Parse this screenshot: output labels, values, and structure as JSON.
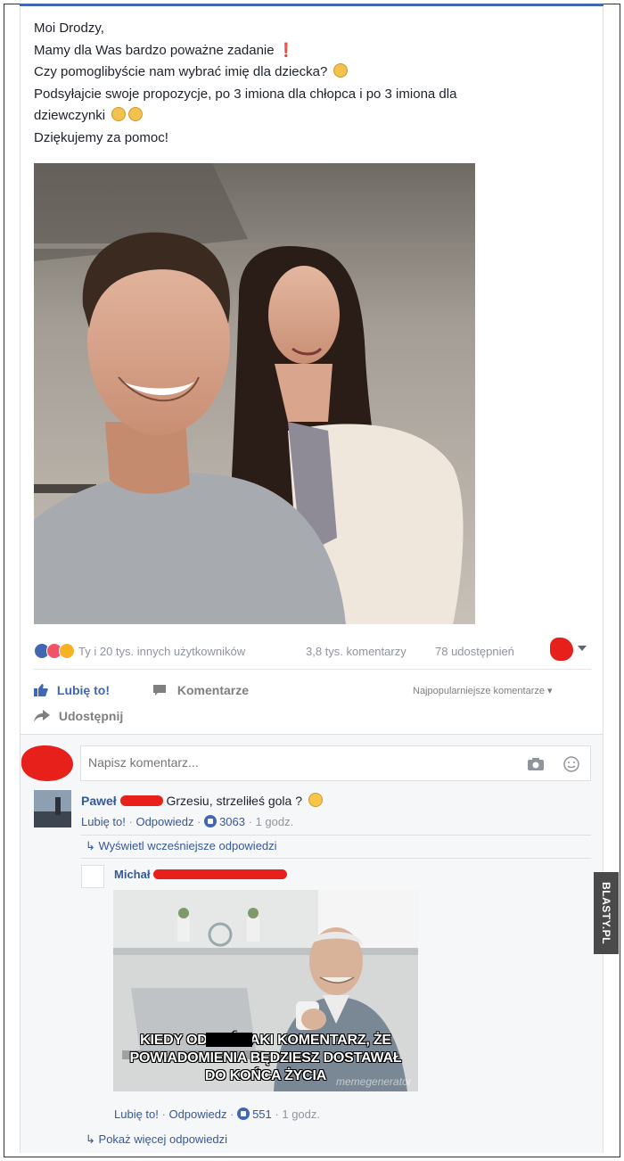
{
  "post": {
    "lines": [
      "Moi Drodzy,",
      "Mamy dla Was bardzo poważne zadanie",
      "Czy pomoglibyście nam wybrać imię dla dziecka?",
      "Podsyłajcie swoje propozycje, po 3 imiona dla chłopca i po 3 imiona dla",
      "dziewczynki",
      "Dziękujemy za pomoc!"
    ],
    "emoji_exclamation": "❗"
  },
  "stats": {
    "reactions_text": "Ty i 20 tys. innych użytkowników",
    "comments_count": "3,8 tys. komentarzy",
    "shares_count": "78 udostępnień"
  },
  "actions": {
    "like": "Lubię to!",
    "comment": "Komentarze",
    "share": "Udostępnij",
    "sort": "Najpopularniejsze komentarze"
  },
  "comment_box": {
    "placeholder": "Napisz komentarz..."
  },
  "comments": [
    {
      "author": "Paweł",
      "text": "Grzesiu, strzeliłeś gola ?",
      "like": "Lubię to!",
      "reply": "Odpowiedz",
      "likes": "3063",
      "time": "1 godz."
    }
  ],
  "view_previous_replies": "Wyświetl wcześniejsze odpowiedzi",
  "reply": {
    "author": "Michał",
    "meme_caption_lines": [
      "KIEDY OD        ŁEŚ TAKI KOMENTARZ, ŻE",
      "POWIADOMIENIA BĘDZIESZ DOSTAWAŁ",
      "DO KOŃCA ŻYCIA"
    ],
    "meme_watermark": "memegenerator",
    "like": "Lubię to!",
    "reply": "Odpowiedz",
    "likes": "551",
    "time": "1 godz."
  },
  "show_more_replies": "Pokaż więcej odpowiedzi",
  "watermark": "BLASTY.PL",
  "colors": {
    "brand_blue": "#4267b2",
    "link_blue": "#365899",
    "redaction_red": "#e8201b"
  }
}
